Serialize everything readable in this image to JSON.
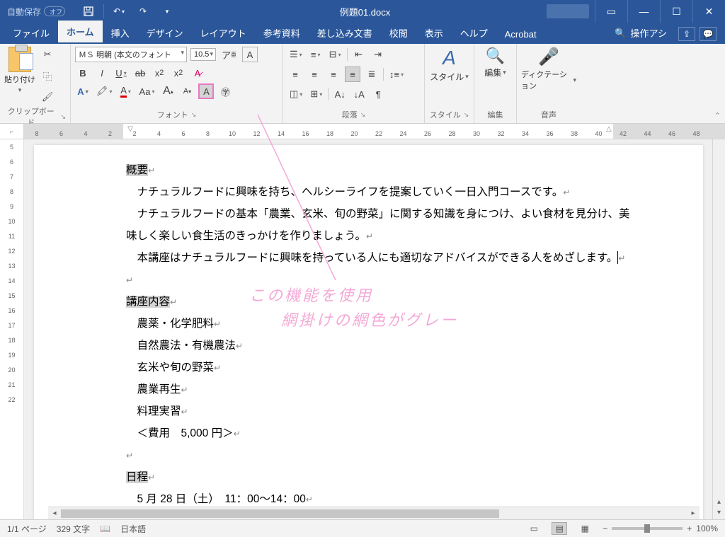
{
  "titlebar": {
    "autosave_label": "自動保存",
    "autosave_state": "オフ",
    "doc_title": "例題01.docx"
  },
  "tabs": {
    "file": "ファイル",
    "home": "ホーム",
    "insert": "挿入",
    "design": "デザイン",
    "layout": "レイアウト",
    "references": "参考資料",
    "mailings": "差し込み文書",
    "review": "校閲",
    "view": "表示",
    "help": "ヘルプ",
    "acrobat": "Acrobat",
    "search_placeholder": "操作アシ"
  },
  "ribbon": {
    "clipboard": {
      "label": "クリップボード",
      "paste": "貼り付け"
    },
    "font": {
      "label": "フォント",
      "font_name": "ＭＳ 明朝 (本文のフォント",
      "font_size": "10.5"
    },
    "paragraph": {
      "label": "段落"
    },
    "styles": {
      "label": "スタイル",
      "btn": "スタイル"
    },
    "editing": {
      "label": "編集",
      "btn": "編集"
    },
    "voice": {
      "label": "音声",
      "btn": "ディクテーション"
    }
  },
  "ruler": {
    "ticks": [
      "8",
      "6",
      "4",
      "2",
      "2",
      "4",
      "6",
      "8",
      "10",
      "12",
      "14",
      "16",
      "18",
      "20",
      "22",
      "24",
      "26",
      "28",
      "30",
      "32",
      "34",
      "36",
      "38",
      "40",
      "42",
      "44",
      "46",
      "48"
    ]
  },
  "vruler": [
    "5",
    "6",
    "7",
    "8",
    "9",
    "10",
    "11",
    "12",
    "13",
    "14",
    "15",
    "16",
    "17",
    "18",
    "19",
    "20",
    "21",
    "22"
  ],
  "document": {
    "h1": "概要",
    "p1": "　ナチュラルフードに興味を持ち、ヘルシーライフを提案していく一日入門コースです。",
    "p2": "　ナチュラルフードの基本「農業、玄米、旬の野菜」に関する知識を身につけ、よい食材を見分け、美味しく楽しい食生活のきっかけを作りましょう。",
    "p3_a": "　本講座はナチュラルフードに興味を持っている人にも適切なアドバイスができる人をめざします。",
    "h2": "講座内容",
    "li1": "　農薬・化学肥料",
    "li2": "　自然農法・有機農法",
    "li3": "　玄米や旬の野菜",
    "li4": "　農業再生",
    "li5": "　料理実習",
    "li6": "　＜費用　5,000 円＞",
    "h3": "日程",
    "li7": "　5 月 28 日（土）　11：00～14：00"
  },
  "annotation": {
    "line1": "この機能を使用",
    "line2": "　網掛けの網色がグレー"
  },
  "statusbar": {
    "page": "1/1 ページ",
    "words": "329 文字",
    "lang": "日本語",
    "zoom": "100%"
  }
}
